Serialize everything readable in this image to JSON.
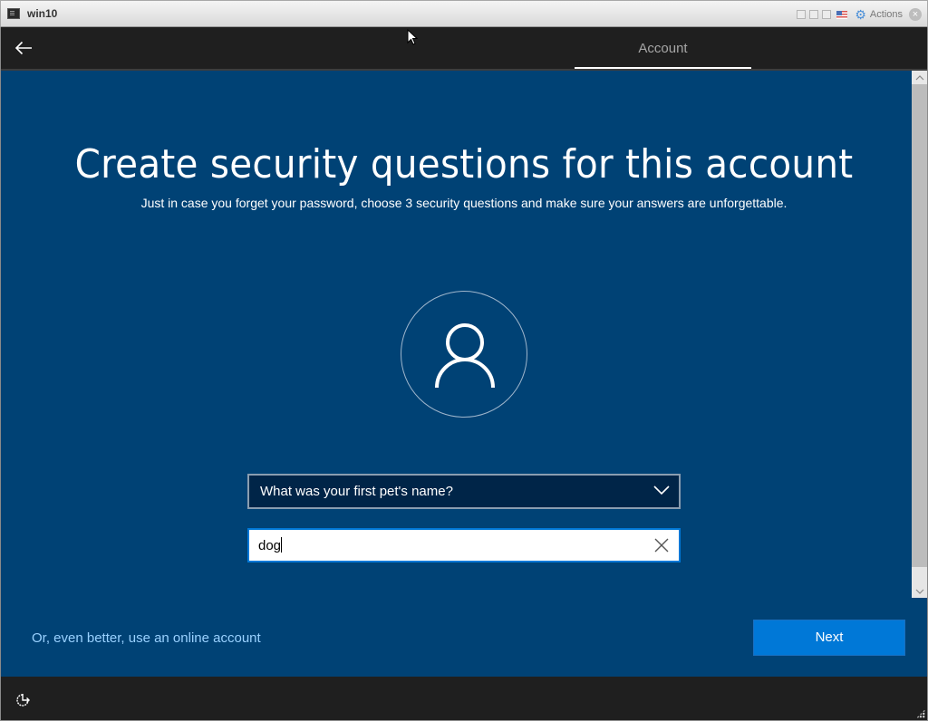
{
  "vm_window": {
    "title": "win10",
    "actions_label": "Actions",
    "icons": [
      "terminal-icon",
      "window-restore-icon",
      "window-minimize-icon",
      "window-maximize-icon",
      "us-flag-icon",
      "gear-icon",
      "close-icon"
    ]
  },
  "top_bar": {
    "back_icon": "arrow-left-icon",
    "tabs": [
      {
        "label": "Account",
        "active": true
      }
    ]
  },
  "main": {
    "title": "Create security questions for this account",
    "subtitle": "Just in case you forget your password, choose 3 security questions and make sure your answers are unforgettable.",
    "avatar_icon": "user-icon",
    "security_question": {
      "selected": "What was your first pet's name?",
      "icon": "chevron-down-icon"
    },
    "answer_input": {
      "value": "dog",
      "clear_icon": "close-icon"
    },
    "online_account_link": "Or, even better, use an online account",
    "next_button": "Next"
  },
  "bottom_bar": {
    "ease_of_access_icon": "ease-of-access-icon"
  },
  "colors": {
    "background": "#004275",
    "bar": "#1f1f1f",
    "accent": "#0078d7",
    "link": "#99d1ff",
    "select_bg": "#002548"
  }
}
